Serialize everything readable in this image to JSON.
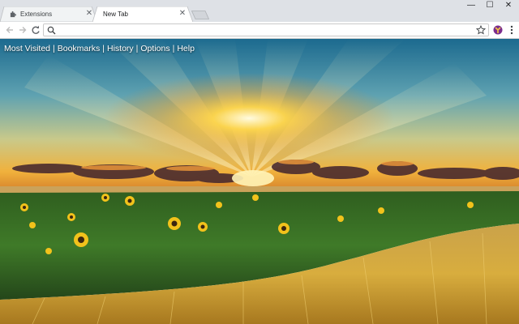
{
  "tabs": [
    {
      "label": "Extensions",
      "icon": "puzzle-icon",
      "active": false
    },
    {
      "label": "New Tab",
      "active": true
    }
  ],
  "window_controls": {
    "minimize": "—",
    "maximize": "☐",
    "close": "✕"
  },
  "address_bar": {
    "value": "",
    "placeholder": ""
  },
  "nav_links": {
    "items": [
      "Most Visited",
      "Bookmarks",
      "History",
      "Options",
      "Help"
    ],
    "separator": "|"
  },
  "background": {
    "scene": "sunset over sunflower and wheat field"
  },
  "colors": {
    "tabstrip": "#dee1e6",
    "active_tab": "#ffffff",
    "link_text": "#ffffff"
  }
}
